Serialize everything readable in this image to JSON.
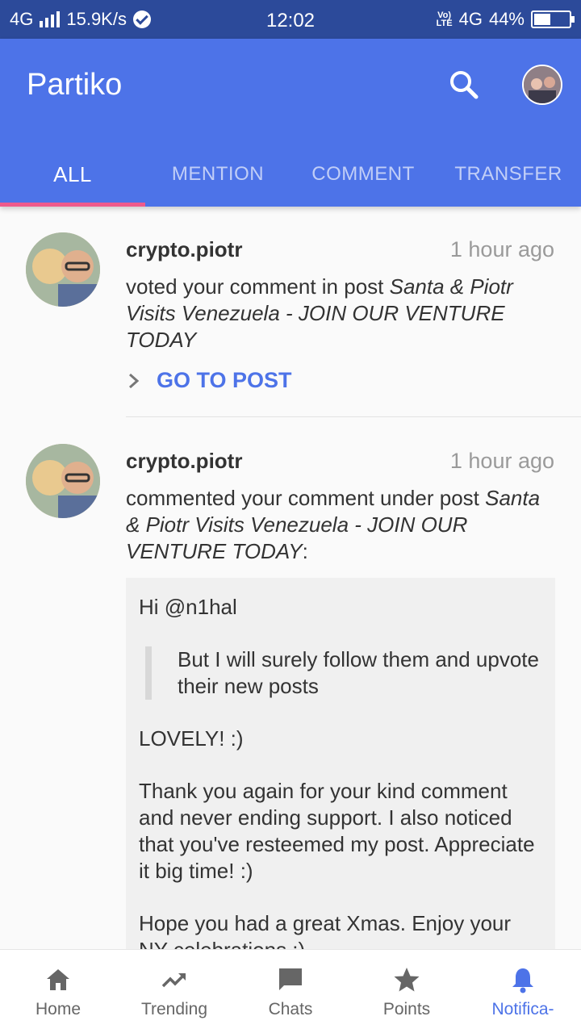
{
  "status_bar": {
    "network_left": "4G",
    "speed": "15.9K/s",
    "time": "12:02",
    "volte": "Vo) LTE",
    "network_right": "4G",
    "battery": "44%"
  },
  "app": {
    "title": "Partiko",
    "colors": {
      "primary": "#4d73e8",
      "tab_indicator": "#ee5a8c",
      "status_bar": "#2c4a9a"
    }
  },
  "tabs": [
    {
      "label": "ALL",
      "active": true
    },
    {
      "label": "MENTION",
      "active": false
    },
    {
      "label": "COMMENT",
      "active": false
    },
    {
      "label": "TRANSFER",
      "active": false
    }
  ],
  "notifications": [
    {
      "user": "crypto.piotr",
      "time": "1 hour ago",
      "action": "voted your comment in post ",
      "post_title": "Santa & Piotr Visits Venezuela - JOIN OUR VENTURE TODAY",
      "link_label": "GO TO POST"
    },
    {
      "user": "crypto.piotr",
      "time": "1 hour ago",
      "action": "commented your comment under post ",
      "post_title": "Santa & Piotr Visits Venezuela - JOIN OUR VENTURE TODAY",
      "suffix": ":",
      "comment": {
        "greeting": "Hi @n1hal",
        "quote": "But I will surely follow them and upvote their new posts",
        "line2": "LOVELY! :)",
        "line3": "Thank you again for your kind comment and never ending support. I also noticed that you've resteemed my post. Appreciate it big time! :)",
        "line4": "Hope you had a great Xmas. Enjoy your NY celebrations :)"
      }
    }
  ],
  "bottom_nav": [
    {
      "label": "Home",
      "icon": "home-icon"
    },
    {
      "label": "Trending",
      "icon": "trending-icon"
    },
    {
      "label": "Chats",
      "icon": "chat-icon"
    },
    {
      "label": "Points",
      "icon": "star-icon"
    },
    {
      "label": "Notifica-",
      "icon": "bell-icon",
      "active": true
    }
  ]
}
